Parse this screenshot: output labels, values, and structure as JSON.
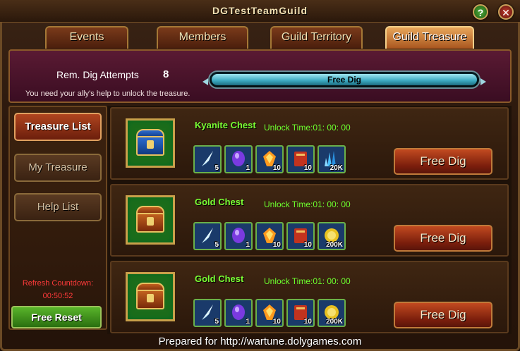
{
  "window": {
    "title": "DGTestTeamGuild",
    "help_label": "?",
    "close_label": "✕"
  },
  "tabs": [
    {
      "label": "Events",
      "active": false
    },
    {
      "label": "Members",
      "active": false
    },
    {
      "label": "Guild Territory",
      "active": false
    },
    {
      "label": "Guild Treasure",
      "active": true
    }
  ],
  "dig": {
    "attempts_label": "Rem. Dig Attempts",
    "attempts_value": "8",
    "bar_label": "Free Dig",
    "bar_fill": 1.0,
    "hint": "You need your ally's help to unlock the treasure."
  },
  "sidebar": {
    "items": [
      {
        "label": "Treasure List",
        "active": true
      },
      {
        "label": "My Treasure",
        "active": false
      },
      {
        "label": "Help List",
        "active": false
      }
    ],
    "refresh_label": "Refresh Countdown:",
    "refresh_value": "00:50:52",
    "reset_label": "Free Reset"
  },
  "chests": [
    {
      "name": "Kyanite Chest",
      "unlock": "Unlock Time:01: 00: 00",
      "button": "Free Dig",
      "items": [
        {
          "icon": "crystal-feather-icon",
          "count": "5"
        },
        {
          "icon": "orb-egg-icon",
          "count": "1"
        },
        {
          "icon": "fire-gem-icon",
          "count": "10"
        },
        {
          "icon": "book-icon",
          "count": "10"
        },
        {
          "icon": "kyanite-crystal-icon",
          "count": "20K"
        }
      ]
    },
    {
      "name": "Gold Chest",
      "unlock": "Unlock Time:01: 00: 00",
      "button": "Free Dig",
      "items": [
        {
          "icon": "crystal-feather-icon",
          "count": "5"
        },
        {
          "icon": "orb-egg-icon",
          "count": "1"
        },
        {
          "icon": "fire-gem-icon",
          "count": "10"
        },
        {
          "icon": "book-icon",
          "count": "10"
        },
        {
          "icon": "gold-coin-icon",
          "count": "200K"
        }
      ]
    },
    {
      "name": "Gold Chest",
      "unlock": "Unlock Time:01: 00: 00",
      "button": "Free Dig",
      "items": [
        {
          "icon": "crystal-feather-icon",
          "count": "5"
        },
        {
          "icon": "orb-egg-icon",
          "count": "1"
        },
        {
          "icon": "fire-gem-icon",
          "count": "10"
        },
        {
          "icon": "book-icon",
          "count": "10"
        },
        {
          "icon": "gold-coin-icon",
          "count": "200K"
        }
      ]
    }
  ],
  "footer": "Prepared for http://wartune.dolygames.com"
}
